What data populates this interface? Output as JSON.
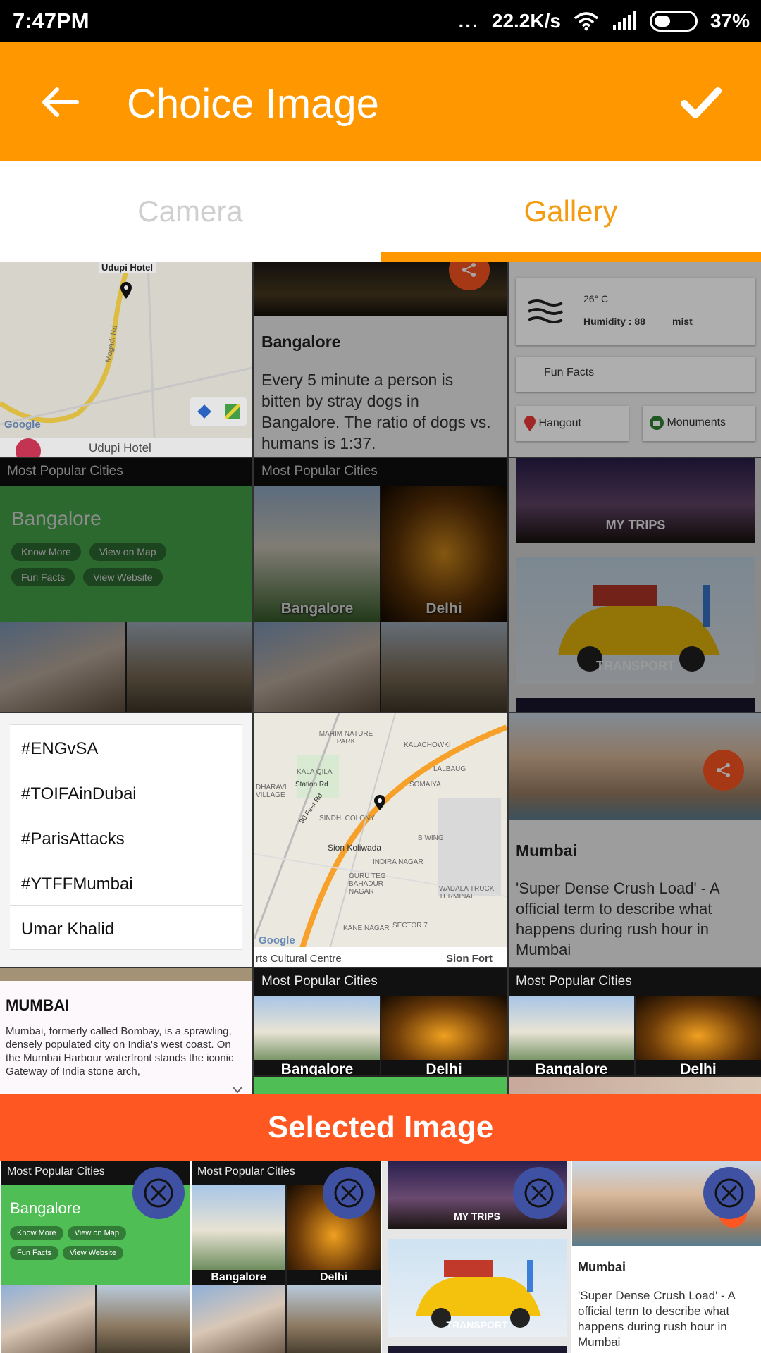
{
  "status_bar": {
    "time": "7:47PM",
    "dots": "...",
    "network_speed": "22.2K/s",
    "battery": "37%"
  },
  "app_bar": {
    "title": "Choice Image",
    "back_icon": "arrow-back-icon",
    "confirm_icon": "check-icon"
  },
  "tabs": [
    {
      "label": "Camera",
      "active": false
    },
    {
      "label": "Gallery",
      "active": true
    }
  ],
  "colors": {
    "accent": "#ff9800",
    "tab_active": "#f39c12",
    "banner": "#ff5722",
    "remove_button": "#3f51a3"
  },
  "gallery": {
    "map_cell_1": {
      "labels": [
        "Udupi Hotel",
        "Udupi Hotel"
      ],
      "google": "Google",
      "road": "Mogadi Rd"
    },
    "bangalore_fact": {
      "title": "Bangalore",
      "text": "Every 5 minute a person is bitten by stray dogs in Bangalore. The ratio of dogs vs. humans is 1:37."
    },
    "weather": {
      "temp": "26° C",
      "humidity": "Humidity : 88",
      "condition": "mist",
      "fun_facts": "Fun Facts",
      "hangout": "Hangout",
      "monuments": "Monuments"
    },
    "popular_1": {
      "header": "Most Popular Cities",
      "city": "Bangalore",
      "chips": [
        "Know More",
        "View on Map",
        "Fun Facts",
        "View Website"
      ]
    },
    "popular_2": {
      "header": "Most Popular Cities",
      "left": "Bangalore",
      "right": "Delhi"
    },
    "trips": {
      "my_trips": "MY TRIPS",
      "transport": "TRANSPORT"
    },
    "trending": [
      "#ENGvSA",
      "#TOIFAinDubai",
      "#ParisAttacks",
      "#YTFFMumbai",
      "Umar Khalid"
    ],
    "map_cell_2": {
      "labels": [
        "MAHIM NATURE PARK",
        "KALACHOWKI",
        "KALA QILA",
        "LALBAUG",
        "DHARAVI VILLAGE",
        "Station Rd",
        "SOMAIYA",
        "90 Feet Rd",
        "SINDHI COLONY",
        "B WING",
        "Sion Koliwada",
        "INDIRA NAGAR",
        "GURU TEG BAHADUR NAGAR",
        "WADALA TRUCK TERMINAL",
        "KANE NAGAR",
        "SECTOR 7",
        "rts Cultural Centre",
        "Sion Fort"
      ],
      "google": "Google"
    },
    "mumbai_fact": {
      "title": "Mumbai",
      "text": "'Super Dense Crush Load' - A official term to describe what happens during rush hour in Mumbai"
    },
    "mumbai_info": {
      "title": "MUMBAI",
      "text": "Mumbai, formerly called Bombay, is a sprawling, densely populated city on India's west coast. On the Mumbai Harbour waterfront stands the iconic Gateway of India stone arch,"
    },
    "popular_3": {
      "header": "Most Popular Cities",
      "left": "Bangalore",
      "right": "Delhi"
    },
    "popular_4": {
      "header": "Most Popular Cities",
      "left": "Bangalore",
      "right": "Delhi"
    }
  },
  "selected_banner": "Selected Image",
  "selected": {
    "s1": {
      "header": "Most Popular Cities",
      "city": "Bangalore",
      "chips": [
        "Know More",
        "View on Map",
        "Fun Facts",
        "View Website"
      ]
    },
    "s2": {
      "header": "Most Popular Cities",
      "left": "Bangalore",
      "right": "Delhi"
    },
    "s3": {
      "my_trips": "MY TRIPS",
      "transport": "TRANSPORT"
    },
    "s4": {
      "title": "Mumbai",
      "text": "'Super Dense Crush Load' - A official term to describe what happens during rush hour in Mumbai"
    }
  }
}
